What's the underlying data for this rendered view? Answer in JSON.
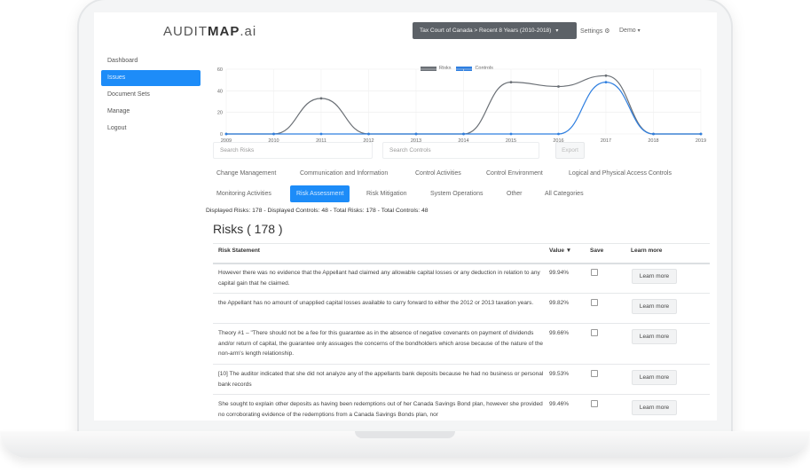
{
  "header": {
    "logo_light_a": "AUDIT",
    "logo_bold": "MAP",
    "logo_light_b": ".ai",
    "scope_label": "Tax Court of Canada > Recent 8 Years (2010-2018)",
    "settings_label": "Settings",
    "user_label": "Demo"
  },
  "sidebar": {
    "items": [
      {
        "label": "Dashboard"
      },
      {
        "label": "Issues"
      },
      {
        "label": "Document Sets"
      },
      {
        "label": "Manage"
      },
      {
        "label": "Logout"
      }
    ]
  },
  "colors": {
    "accent": "#1d8cf8",
    "risks_series": "#6b7076",
    "controls_series": "#2f7fe0"
  },
  "chart_data": {
    "type": "line",
    "x": [
      2009,
      2010,
      2011,
      2012,
      2013,
      2014,
      2015,
      2016,
      2017,
      2018,
      2019
    ],
    "ylim": [
      0,
      60
    ],
    "yticks": [
      0,
      20,
      40,
      60
    ],
    "series": [
      {
        "name": "Risks",
        "values": [
          0,
          0,
          33,
          0,
          0,
          0,
          48,
          44,
          54,
          0,
          0
        ]
      },
      {
        "name": "Controls",
        "values": [
          0,
          0,
          0,
          0,
          0,
          0,
          0,
          0,
          48,
          0,
          0
        ]
      }
    ],
    "legend": "top-center",
    "grid": true
  },
  "filters": {
    "search_risks_placeholder": "Search Risks",
    "search_controls_placeholder": "Search Controls",
    "export_label": "Export"
  },
  "categories": [
    "Change Management",
    "Communication and Information",
    "Control Activities",
    "Control Environment",
    "Logical and Physical Access Controls",
    "Monitoring Activities",
    "Risk Assessment",
    "Risk Mitigation",
    "System Operations",
    "Other",
    "All Categories"
  ],
  "summary": "Displayed Risks: 178 - Displayed Controls: 48 - Total Risks: 178 - Total Controls: 48",
  "risks_title": "Risks ( 178 )",
  "table": {
    "headers": {
      "statement": "Risk Statement",
      "value": "Value ▼",
      "save": "Save",
      "learn": "Learn more"
    },
    "button_label": "Learn more",
    "rows": [
      {
        "statement": "However there was no evidence that the Appellant had claimed any allowable capital losses or any deduction in relation to any capital gain that he claimed.",
        "value": "99.94%"
      },
      {
        "statement": "the Appellant has no amount of unapplied capital losses available to carry forward to either the 2012 or 2013 taxation years.",
        "value": "99.82%"
      },
      {
        "statement": "Theory #1 – \"There should not be a fee for this guarantee as in the absence of negative covenants on payment of dividends and/or return of capital, the guarantee only assuages the concerns of the bondholders which arose because of the nature of the non-arm's length relationship.",
        "value": "99.66%"
      },
      {
        "statement": "[10] The auditor indicated that she did not analyze any of the appellants bank deposits because he had no business or personal bank records",
        "value": "99.53%"
      },
      {
        "statement": "She sought to explain other deposits as having been redemptions out of her Canada Savings Bond plan, however she provided no corroborating evidence of the redemptions from a Canada Savings Bonds plan, nor",
        "value": "99.46%"
      }
    ]
  }
}
